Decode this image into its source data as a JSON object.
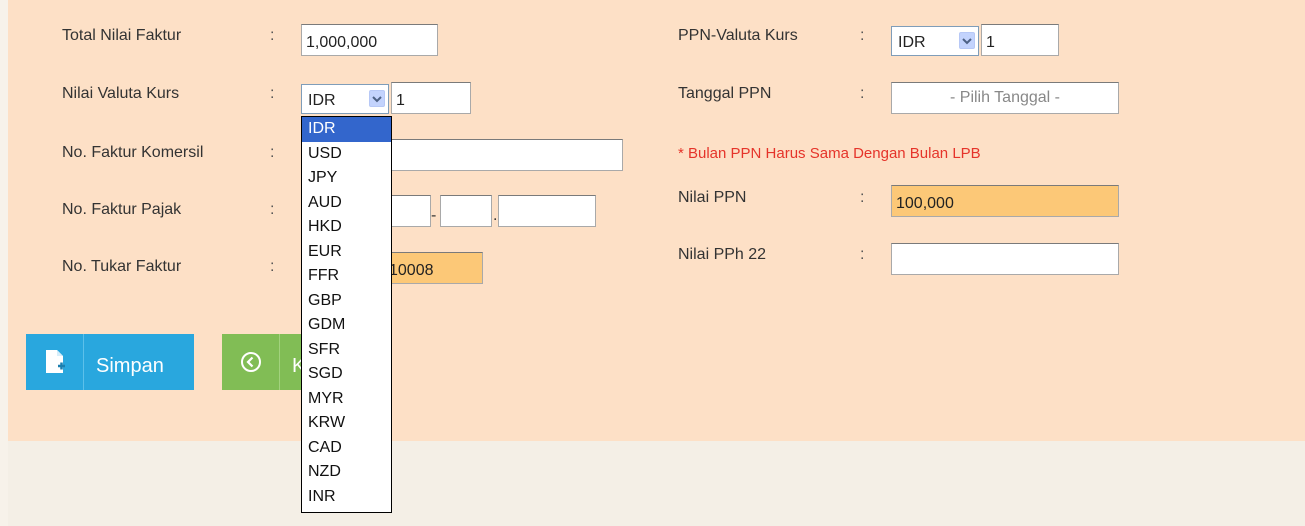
{
  "form": {
    "total_nilai_faktur": {
      "label": "Total Nilai Faktur",
      "value": "1,000,000"
    },
    "nilai_valuta_kurs": {
      "label": "Nilai Valuta Kurs",
      "currency": "IDR",
      "rate": "1"
    },
    "no_faktur_komersil": {
      "label": "No. Faktur Komersil",
      "value": ""
    },
    "no_faktur_pajak": {
      "label": "No. Faktur Pajak",
      "sep1": "-",
      "sep2": "."
    },
    "no_tukar_faktur": {
      "label": "No. Tukar Faktur",
      "value": "10008"
    },
    "ppn_valuta_kurs": {
      "label": "PPN-Valuta Kurs",
      "currency": "IDR",
      "rate": "1"
    },
    "tanggal_ppn": {
      "label": "Tanggal PPN",
      "placeholder": "- Pilih Tanggal -"
    },
    "note": "* Bulan PPN Harus Sama Dengan Bulan LPB",
    "nilai_ppn": {
      "label": "Nilai PPN",
      "value": "100,000"
    },
    "nilai_pph22": {
      "label": "Nilai PPh 22",
      "value": ""
    },
    "colon": ":"
  },
  "buttons": {
    "save_label": "Simpan",
    "back_label_partial": "K"
  },
  "currency_dropdown": {
    "options": [
      "IDR",
      "USD",
      "JPY",
      "AUD",
      "HKD",
      "EUR",
      "FFR",
      "GBP",
      "GDM",
      "SFR",
      "SGD",
      "MYR",
      "KRW",
      "CAD",
      "NZD",
      "INR"
    ],
    "selected": "IDR"
  },
  "colors": {
    "panel_bg": "#fde0c6",
    "save_button": "#29a7de",
    "back_button": "#81bd55",
    "highlight_field": "#fcc877",
    "note_text": "#e5342a",
    "selected_option": "#3366cc"
  },
  "icons": {
    "save": "document-add-icon",
    "back": "circle-arrow-left-icon",
    "dropdown": "chevron-down-icon"
  }
}
